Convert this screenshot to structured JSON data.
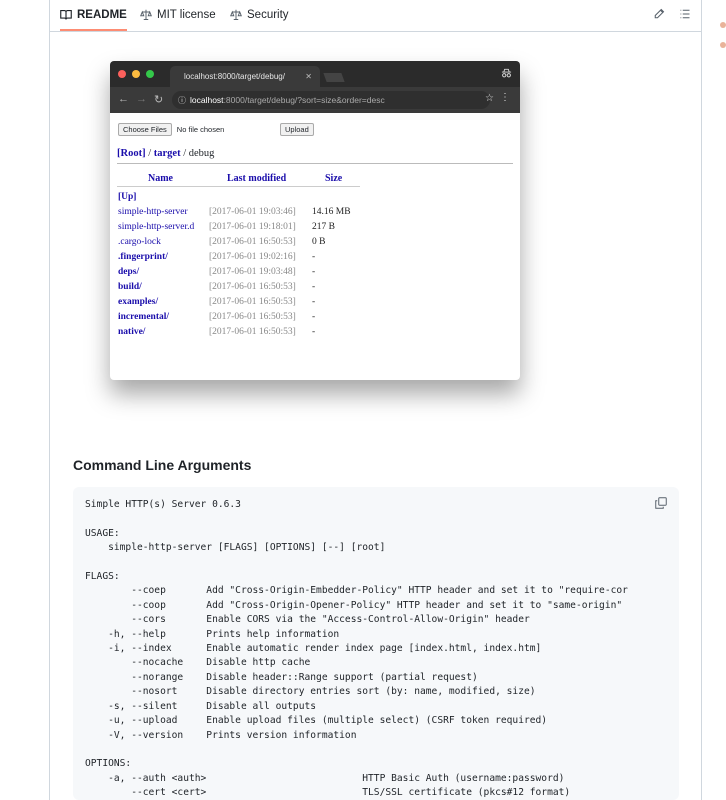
{
  "tabs": [
    {
      "label": "README",
      "icon": "book-icon",
      "active": true
    },
    {
      "label": "MIT license",
      "icon": "law-icon",
      "active": false
    },
    {
      "label": "Security",
      "icon": "law-icon",
      "active": false
    }
  ],
  "tab_actions": {
    "edit_icon": "pencil-icon",
    "outline_icon": "list-icon"
  },
  "browser": {
    "tab_title": "localhost:8000/target/debug/",
    "url_host": "localhost",
    "url_path": ":8000/target/debug/?sort=size&order=desc",
    "choose_files": "Choose Files",
    "no_file": "No file chosen",
    "upload": "Upload",
    "crumb_root": "[Root]",
    "crumb_sep1": " / ",
    "crumb_target": "target",
    "crumb_sep2": " / ",
    "crumb_current": "debug",
    "columns": {
      "name": "Name",
      "modified": "Last modified",
      "size": "Size"
    },
    "up": "[Up]",
    "files": [
      {
        "name": "simple-http-server",
        "date": "[2017-06-01 19:03:46]",
        "size": "14.16 MB",
        "bold": false
      },
      {
        "name": "simple-http-server.d",
        "date": "[2017-06-01 19:18:01]",
        "size": "217 B",
        "bold": false
      },
      {
        "name": ".cargo-lock",
        "date": "[2017-06-01 16:50:53]",
        "size": "0 B",
        "bold": false
      },
      {
        "name": ".fingerprint/",
        "date": "[2017-06-01 19:02:16]",
        "size": "-",
        "bold": true
      },
      {
        "name": "deps/",
        "date": "[2017-06-01 19:03:48]",
        "size": "-",
        "bold": true
      },
      {
        "name": "build/",
        "date": "[2017-06-01 16:50:53]",
        "size": "-",
        "bold": true
      },
      {
        "name": "examples/",
        "date": "[2017-06-01 16:50:53]",
        "size": "-",
        "bold": true
      },
      {
        "name": "incremental/",
        "date": "[2017-06-01 16:50:53]",
        "size": "-",
        "bold": true
      },
      {
        "name": "native/",
        "date": "[2017-06-01 16:50:53]",
        "size": "-",
        "bold": true
      }
    ]
  },
  "section_heading": "Command Line Arguments",
  "code_lines": [
    "Simple HTTP(s) Server 0.6.3",
    "",
    "USAGE:",
    "    simple-http-server [FLAGS] [OPTIONS] [--] [root]",
    "",
    "FLAGS:",
    "        --coep       Add \"Cross-Origin-Embedder-Policy\" HTTP header and set it to \"require-cor",
    "        --coop       Add \"Cross-Origin-Opener-Policy\" HTTP header and set it to \"same-origin\"",
    "        --cors       Enable CORS via the \"Access-Control-Allow-Origin\" header",
    "    -h, --help       Prints help information",
    "    -i, --index      Enable automatic render index page [index.html, index.htm]",
    "        --nocache    Disable http cache",
    "        --norange    Disable header::Range support (partial request)",
    "        --nosort     Disable directory entries sort (by: name, modified, size)",
    "    -s, --silent     Disable all outputs",
    "    -u, --upload     Enable upload files (multiple select) (CSRF token required)",
    "    -V, --version    Prints version information",
    "",
    "OPTIONS:",
    "    -a, --auth <auth>                           HTTP Basic Auth (username:password)",
    "        --cert <cert>                           TLS/SSL certificate (pkcs#12 format)"
  ]
}
